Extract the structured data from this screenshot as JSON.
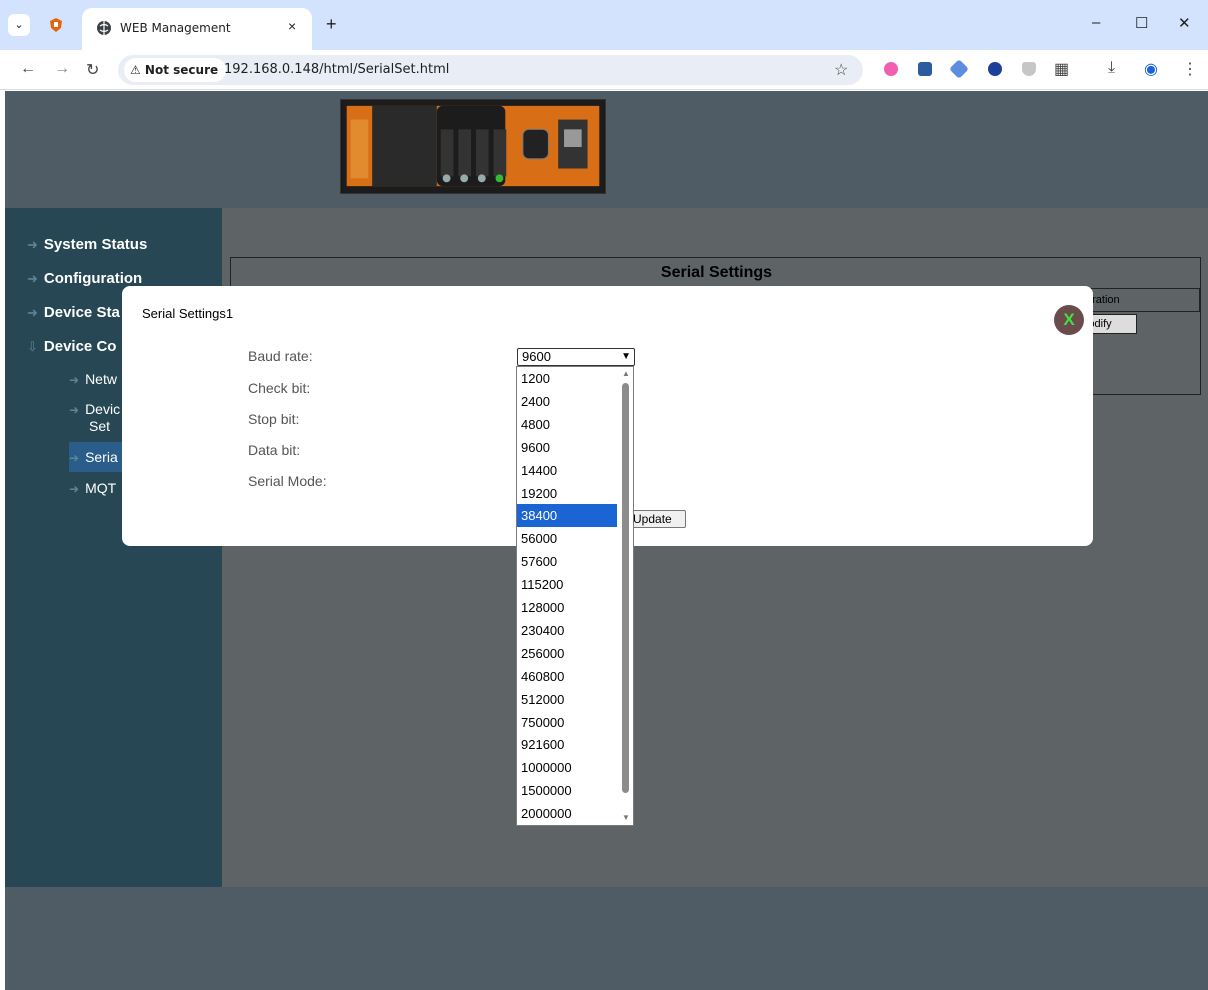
{
  "browser": {
    "tab_title": "WEB Management",
    "tab_close": "×",
    "new_tab": "+",
    "security_label": "⚠ Not secure",
    "url": "192.168.0.148/html/SerialSet.html"
  },
  "sidebar": {
    "items": [
      {
        "label": "System Status"
      },
      {
        "label": "Configuration"
      },
      {
        "label": "Device Sta"
      },
      {
        "label": "Device Co"
      }
    ],
    "sub_items": [
      {
        "label": "Netw"
      },
      {
        "label": "Devic"
      },
      {
        "label": "Set"
      },
      {
        "label": "Seria"
      },
      {
        "label": "MQT"
      }
    ]
  },
  "main": {
    "title": "Serial Settings",
    "operation_header": "eration",
    "modify_button": "lodify"
  },
  "modal": {
    "title": "Serial Settings1",
    "close_label": "X",
    "fields": [
      {
        "label": "Baud rate:"
      },
      {
        "label": "Check bit:"
      },
      {
        "label": "Stop bit:"
      },
      {
        "label": "Data bit:"
      },
      {
        "label": "Serial Mode:"
      }
    ],
    "baud_selected": "9600",
    "update_button": "Update"
  },
  "dropdown": {
    "options": [
      "1200",
      "2400",
      "4800",
      "9600",
      "14400",
      "19200",
      "38400",
      "56000",
      "57600",
      "115200",
      "128000",
      "230400",
      "256000",
      "460800",
      "512000",
      "750000",
      "921600",
      "1000000",
      "1500000",
      "2000000"
    ],
    "highlighted": "38400"
  },
  "colors": {
    "sidebar_bg": "#264753",
    "content_bg": "#5e6366",
    "highlight": "#1a64d3",
    "close_button": "#6b4c4c"
  }
}
